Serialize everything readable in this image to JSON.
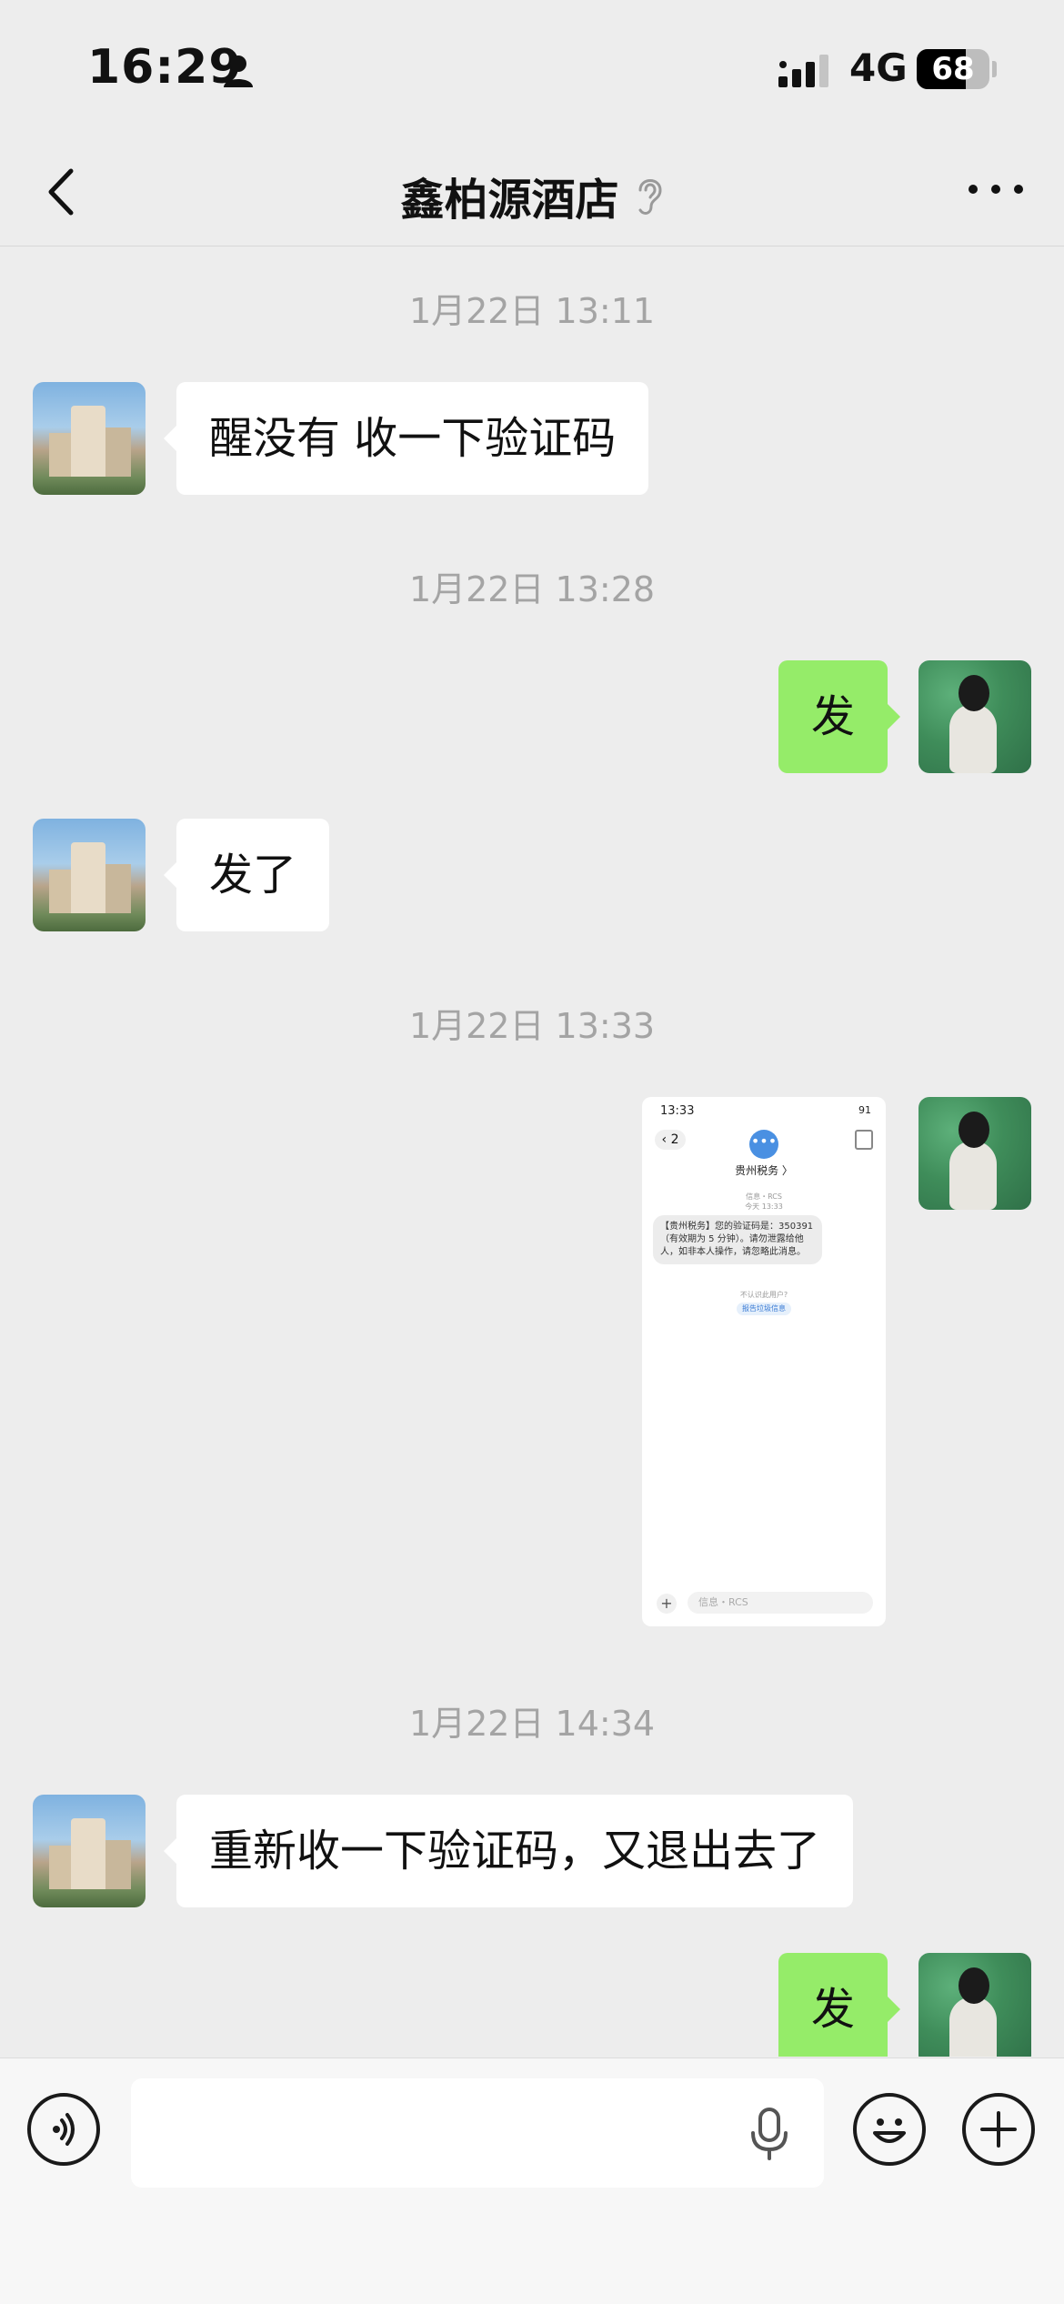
{
  "status_bar": {
    "time": "16:29",
    "network": "4G",
    "battery": "68",
    "battery_level": 0.68
  },
  "header": {
    "title": "鑫柏源酒店",
    "back_icon": "chevron-left-icon",
    "more_icon": "more-dots-icon",
    "ear_icon": "ear-icon"
  },
  "messages": [
    {
      "type": "timestamp",
      "text": "1月22日 13:11"
    },
    {
      "type": "text",
      "from": "other",
      "text": "醒没有  收一下验证码"
    },
    {
      "type": "timestamp",
      "text": "1月22日 13:28"
    },
    {
      "type": "text",
      "from": "me",
      "text": "发"
    },
    {
      "type": "text",
      "from": "other",
      "text": "发了"
    },
    {
      "type": "timestamp",
      "text": "1月22日 13:33"
    },
    {
      "type": "image",
      "from": "me",
      "screenshot": {
        "time": "13:33",
        "battery": "91",
        "back_count": "2",
        "sender": "贵州税务 〉",
        "sub_line1": "信息・RCS",
        "sub_line2": "今天 13:33",
        "message": "【贵州税务】您的验证码是：350391（有效期为 5 分钟）。请勿泄露给他人，如非本人操作，请忽略此消息。",
        "question": "不认识此用户?",
        "action": "报告垃圾信息",
        "input_placeholder": "信息・RCS"
      }
    },
    {
      "type": "timestamp",
      "text": "1月22日 14:34"
    },
    {
      "type": "text",
      "from": "other",
      "text": "重新收一下验证码，又退出去了"
    },
    {
      "type": "text",
      "from": "me",
      "text": "发"
    }
  ],
  "input_bar": {
    "voice_icon": "voice-icon",
    "mic_icon": "mic-icon",
    "emoji_icon": "emoji-icon",
    "plus_icon": "plus-icon"
  },
  "colors": {
    "background": "#ededed",
    "outgoing_bubble": "#95ec69",
    "incoming_bubble": "#ffffff",
    "timestamp": "#a4a4a4"
  }
}
